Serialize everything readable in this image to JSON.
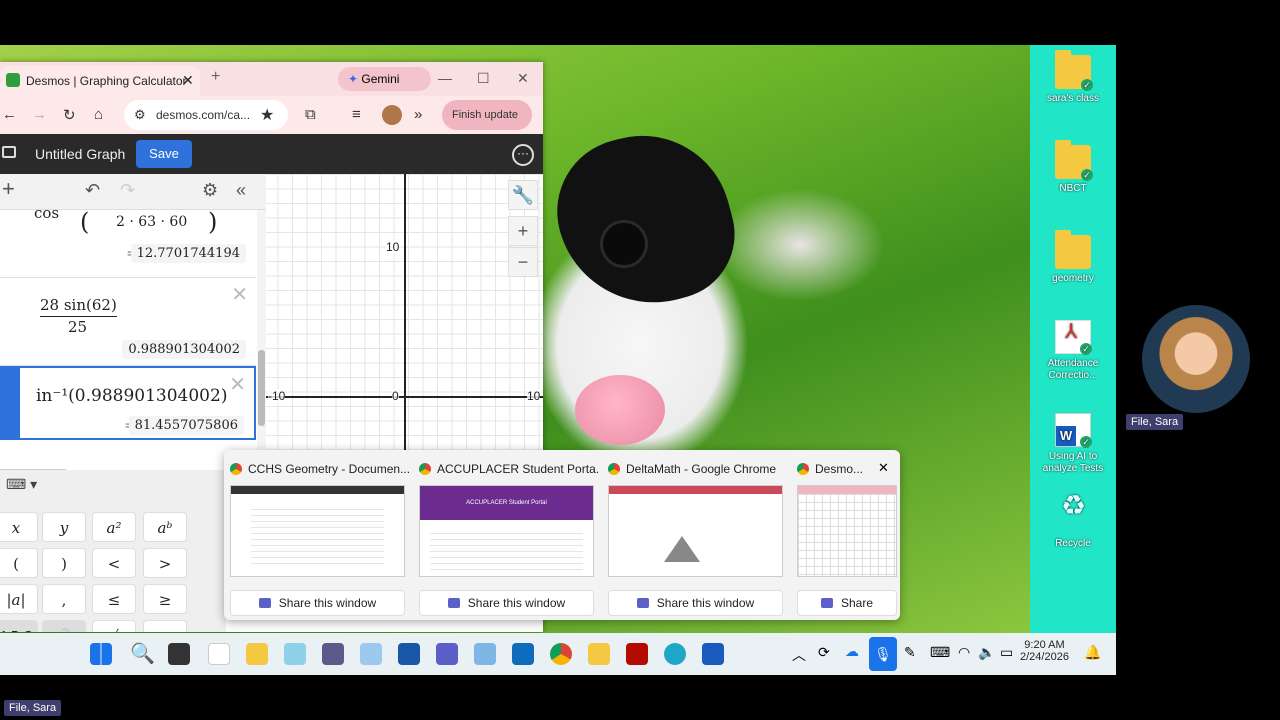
{
  "chrome": {
    "tab_title": "Desmos | Graphing Calculator",
    "gemini_label": "Gemini",
    "url": "desmos.com/ca...",
    "finish_update": "Finish update"
  },
  "desmos": {
    "graph_title": "Untitled Graph",
    "save_label": "Save",
    "expressions": [
      {
        "math": "cos",
        "sub": "2 · 63 · 60",
        "result": "12.7701744194"
      },
      {
        "math_num": "28 sin(62)",
        "math_den": "25",
        "result": "0.988901304002"
      },
      {
        "math": "in⁻¹(0.988901304002)",
        "result": "81.4557075806"
      }
    ],
    "axis_labels": {
      "y_top": "10",
      "x_left": "-10",
      "origin": "0",
      "x_right": "10"
    },
    "keypad": [
      [
        "x",
        "y",
        "a²",
        "aᵇ"
      ],
      [
        "(",
        ")",
        "<",
        ">"
      ],
      [
        "|a|",
        ",",
        "≤",
        "≥"
      ],
      [
        "A B C",
        "🔊",
        "√",
        "π"
      ]
    ],
    "eq_sign": "="
  },
  "share": {
    "windows": [
      {
        "title": "CCHS Geometry - Documen...",
        "button": "Share this window"
      },
      {
        "title": "ACCUPLACER Student Porta...",
        "button": "Share this window"
      },
      {
        "title": "DeltaMath - Google Chrome",
        "button": "Share this window"
      },
      {
        "title": "Desmo...",
        "button": "Share"
      }
    ],
    "thumb_accuplacer": "ACCUPLACER Student Portal",
    "close": "✕"
  },
  "desktop_icons": [
    {
      "label": "sara's class",
      "icon": "folder-icon"
    },
    {
      "label": "NBCT",
      "icon": "folder-icon"
    },
    {
      "label": "geometry",
      "icon": "folder-icon"
    },
    {
      "label": "Attendance Correctio...",
      "icon": "pdf-icon"
    },
    {
      "label": "Using AI to analyze Tests",
      "icon": "word-icon"
    },
    {
      "label": "Recycle",
      "icon": "recycle-bin-icon"
    }
  ],
  "taskbar": {
    "time": "9:20 AM",
    "date": "2/24/2026"
  },
  "participants": {
    "presenter_name": "File, Sara",
    "self_name": "File, Sara"
  }
}
